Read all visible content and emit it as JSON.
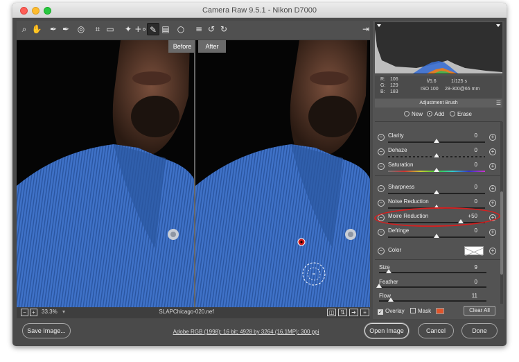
{
  "window": {
    "title": "Camera Raw 9.5.1  -  Nikon D7000"
  },
  "toolbar": {
    "tools": [
      {
        "icon": "zoom-icon",
        "glyph": "⌕"
      },
      {
        "icon": "hand-icon",
        "glyph": "✋"
      },
      {
        "icon": "white-balance-icon",
        "glyph": "✒"
      },
      {
        "icon": "color-sampler-icon",
        "glyph": "✒"
      },
      {
        "icon": "targeted-adjustment-icon",
        "glyph": "◎"
      },
      {
        "icon": "crop-icon",
        "glyph": "⌗"
      },
      {
        "icon": "straighten-icon",
        "glyph": "▭"
      },
      {
        "icon": "spot-removal-icon",
        "glyph": "✦"
      },
      {
        "icon": "red-eye-icon",
        "glyph": "+∘"
      },
      {
        "icon": "adjustment-brush-icon",
        "glyph": "✎"
      },
      {
        "icon": "graduated-filter-icon",
        "glyph": "▤"
      },
      {
        "icon": "radial-filter-icon",
        "glyph": "○"
      },
      {
        "icon": "preferences-icon",
        "glyph": "≡"
      },
      {
        "icon": "rotate-ccw-icon",
        "glyph": "↺"
      },
      {
        "icon": "rotate-cw-icon",
        "glyph": "↻"
      }
    ],
    "export_icon": "open-in-icon"
  },
  "preview": {
    "before_label": "Before",
    "after_label": "After"
  },
  "status": {
    "zoom": "33.3%",
    "filename": "SLAPChicago-020.nef"
  },
  "info": {
    "r_label": "R:",
    "r": "106",
    "g_label": "G:",
    "g": "129",
    "b_label": "B:",
    "b": "183",
    "aperture": "f/5.6",
    "shutter": "1/125 s",
    "iso": "ISO 100",
    "lens": "28-300@65 mm"
  },
  "panel": {
    "title": "Adjustment Brush",
    "modes": {
      "new": "New",
      "add": "Add",
      "erase": "Erase",
      "selected": "Add"
    },
    "sliders": [
      {
        "label": "Clarity",
        "value": "0",
        "level": 0.5
      },
      {
        "label": "Dehaze",
        "value": "0",
        "level": 0.5
      },
      {
        "label": "Saturation",
        "value": "0",
        "level": 0.5
      },
      {
        "label": "Sharpness",
        "value": "0",
        "level": 0.5
      },
      {
        "label": "Noise Reduction",
        "value": "0",
        "level": 0.5
      },
      {
        "label": "Moire Reduction",
        "value": "+50",
        "level": 0.75
      },
      {
        "label": "Defringe",
        "value": "0",
        "level": 0.5
      }
    ],
    "color_label": "Color",
    "brush": [
      {
        "label": "Size",
        "value": "9",
        "level": 0.09
      },
      {
        "label": "Feather",
        "value": "0",
        "level": 0.0
      },
      {
        "label": "Flow",
        "value": "11",
        "level": 0.11
      }
    ],
    "overlay_label": "Overlay",
    "overlay_checked": true,
    "mask_label": "Mask",
    "mask_color": "#e0542a",
    "clear_all": "Clear All",
    "highlight_color": "#d32020"
  },
  "footer": {
    "save": "Save Image...",
    "workflow_link": "Adobe RGB (1998); 16 bit; 4928 by 3264 (16.1MP); 300 ppi",
    "open": "Open Image",
    "cancel": "Cancel",
    "done": "Done"
  }
}
